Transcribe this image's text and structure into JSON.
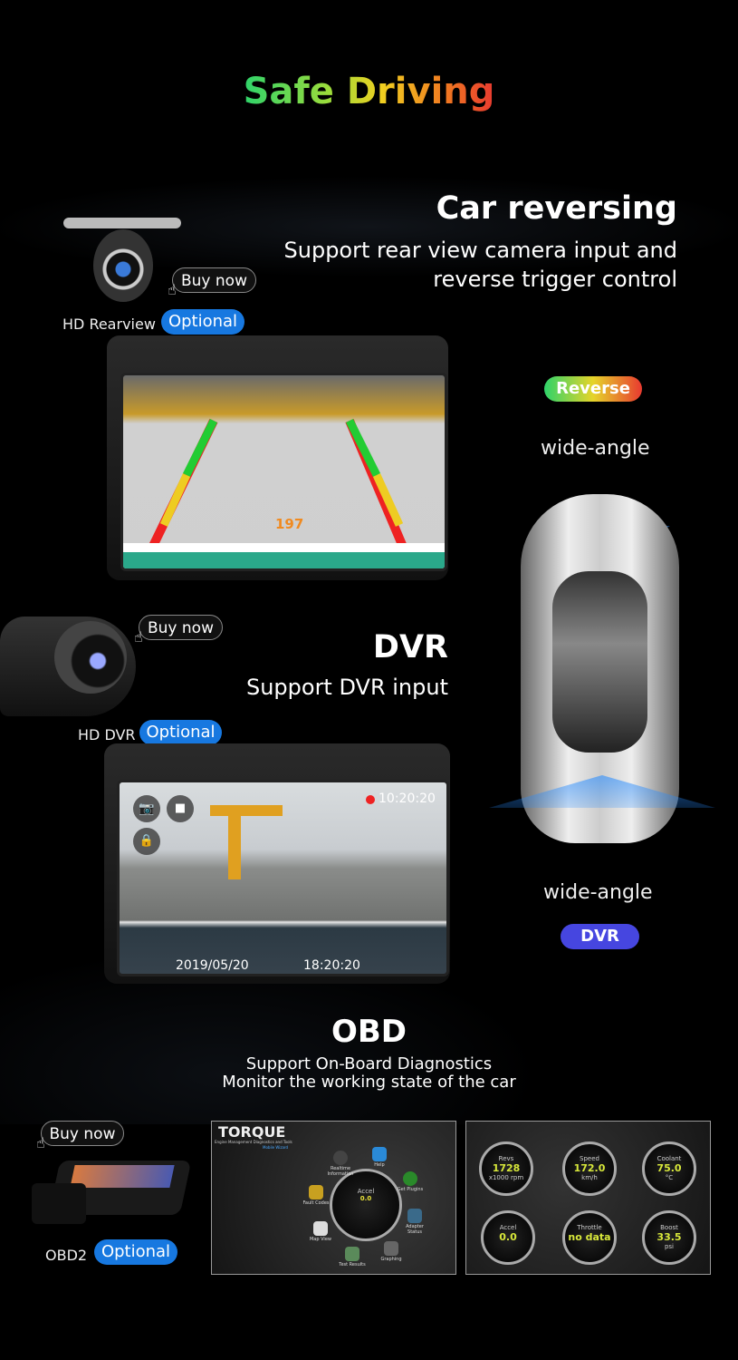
{
  "title": "Safe Driving",
  "reversing": {
    "heading": "Car reversing",
    "line1": "Support rear view camera input and",
    "line2": "reverse trigger control",
    "buy_now": "Buy now",
    "product": "HD Rearview",
    "optional": "Optional",
    "badge": "Reverse",
    "wide_angle": "wide-angle",
    "distance": "197"
  },
  "dvr": {
    "heading": "DVR",
    "line1": "Support DVR input",
    "buy_now": "Buy now",
    "product": "HD DVR",
    "optional": "Optional",
    "badge": "DVR",
    "wide_angle": "wide-angle",
    "rec_time": "10:20:20",
    "date": "2019/05/20",
    "time": "18:20:20"
  },
  "obd": {
    "heading": "OBD",
    "line1": "Support On-Board Diagnostics",
    "line2": "Monitor the working state of the car",
    "buy_now": "Buy now",
    "product": "OBD2",
    "optional": "Optional",
    "torque": {
      "logo": "TORQUE",
      "tagline": "Engine Management Diagnostics and Tools",
      "wizard": "Mobile Wizard",
      "gauge_label": "Accel",
      "gauge_value": "0.0",
      "icons": [
        "Realtime Information",
        "Help",
        "Get Plugins",
        "Fault Codes",
        "Adapter Status",
        "Map View",
        "Test Results",
        "Graphing"
      ]
    },
    "gauges": [
      {
        "label": "Revs",
        "value": "1728",
        "unit": "x1000 rpm"
      },
      {
        "label": "Speed",
        "value": "172.0",
        "unit": "km/h"
      },
      {
        "label": "Coolant",
        "value": "75.0",
        "unit": "°C"
      },
      {
        "label": "Accel",
        "value": "0.0",
        "unit": ""
      },
      {
        "label": "Throttle",
        "value": "no data",
        "unit": ""
      },
      {
        "label": "Boost",
        "value": "33.5",
        "unit": "psi"
      }
    ]
  },
  "colors": {
    "optional": "#1778e0",
    "dvr_badge": "#4646e0",
    "background": "#000000"
  }
}
